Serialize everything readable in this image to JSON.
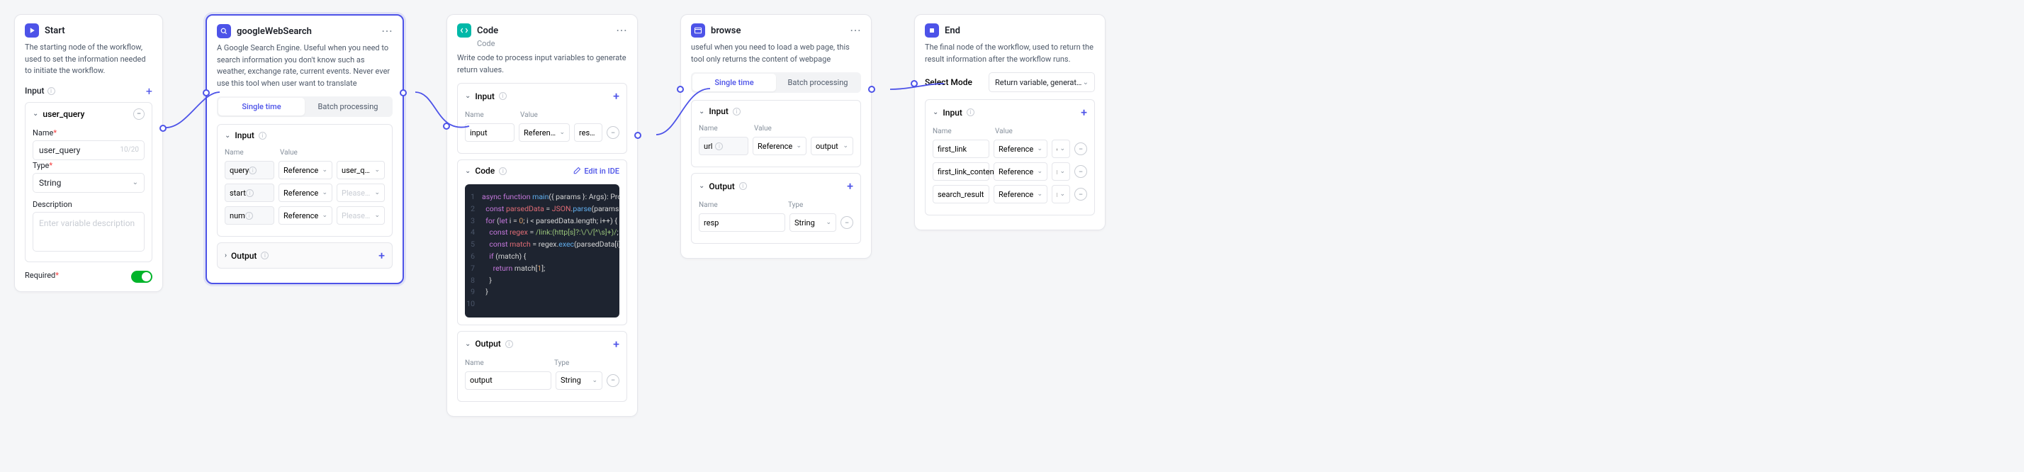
{
  "start": {
    "title": "Start",
    "desc": "The starting node of the workflow, used to set the information needed to initiate the workflow.",
    "input_label": "Input",
    "var_name": "user_query",
    "name_label": "Name",
    "name_value": "user_query",
    "name_counter": "10/20",
    "type_label": "Type",
    "type_value": "String",
    "desc_label": "Description",
    "desc_placeholder": "Enter variable description",
    "required_label": "Required"
  },
  "gws": {
    "title": "googleWebSearch",
    "desc": "A Google Search Engine. Useful when you need to search information you don't know such as weather, exchange rate, current events. Never ever use this tool when user want to translate",
    "seg_single": "Single time",
    "seg_batch": "Batch processing",
    "input_label": "Input",
    "output_label": "Output",
    "col_name": "Name",
    "col_value": "Value",
    "rows": [
      {
        "name": "query",
        "ref": "Reference",
        "val": "user_query",
        "placeholder": false
      },
      {
        "name": "start",
        "ref": "Reference",
        "val": "Please select",
        "placeholder": true
      },
      {
        "name": "num",
        "ref": "Reference",
        "val": "Please select",
        "placeholder": true
      }
    ]
  },
  "code": {
    "title": "Code",
    "subtitle": "Code",
    "desc": "Write code to process input variables to generate return values.",
    "input_label": "Input",
    "code_label": "Code",
    "output_label": "Output",
    "edit_label": "Edit in IDE",
    "col_name": "Name",
    "col_value": "Value",
    "col_type": "Type",
    "input_name": "input",
    "input_ref": "Reference",
    "input_val": "response_for_moc",
    "output_name": "output",
    "output_type": "String"
  },
  "browse": {
    "title": "browse",
    "desc": "useful when you need to load a web page, this tool only returns the content of webpage",
    "seg_single": "Single time",
    "seg_batch": "Batch processing",
    "input_label": "Input",
    "output_label": "Output",
    "col_name": "Name",
    "col_value": "Value",
    "col_type": "Type",
    "url_name": "url",
    "url_ref": "Reference",
    "url_val": "output",
    "resp_name": "resp",
    "resp_type": "String"
  },
  "end": {
    "title": "End",
    "desc": "The final node of the workflow, used to return the result information after the workflow runs.",
    "mode_label": "Select Mode",
    "mode_value": "Return variable, generated by the B...",
    "input_label": "Input",
    "col_name": "Name",
    "col_value": "Value",
    "rows": [
      {
        "name": "first_link",
        "ref": "Reference",
        "val": "output"
      },
      {
        "name": "first_link_content",
        "ref": "Reference",
        "val": "resp"
      },
      {
        "name": "search_result",
        "ref": "Reference",
        "val": "response_for_moc"
      }
    ]
  }
}
